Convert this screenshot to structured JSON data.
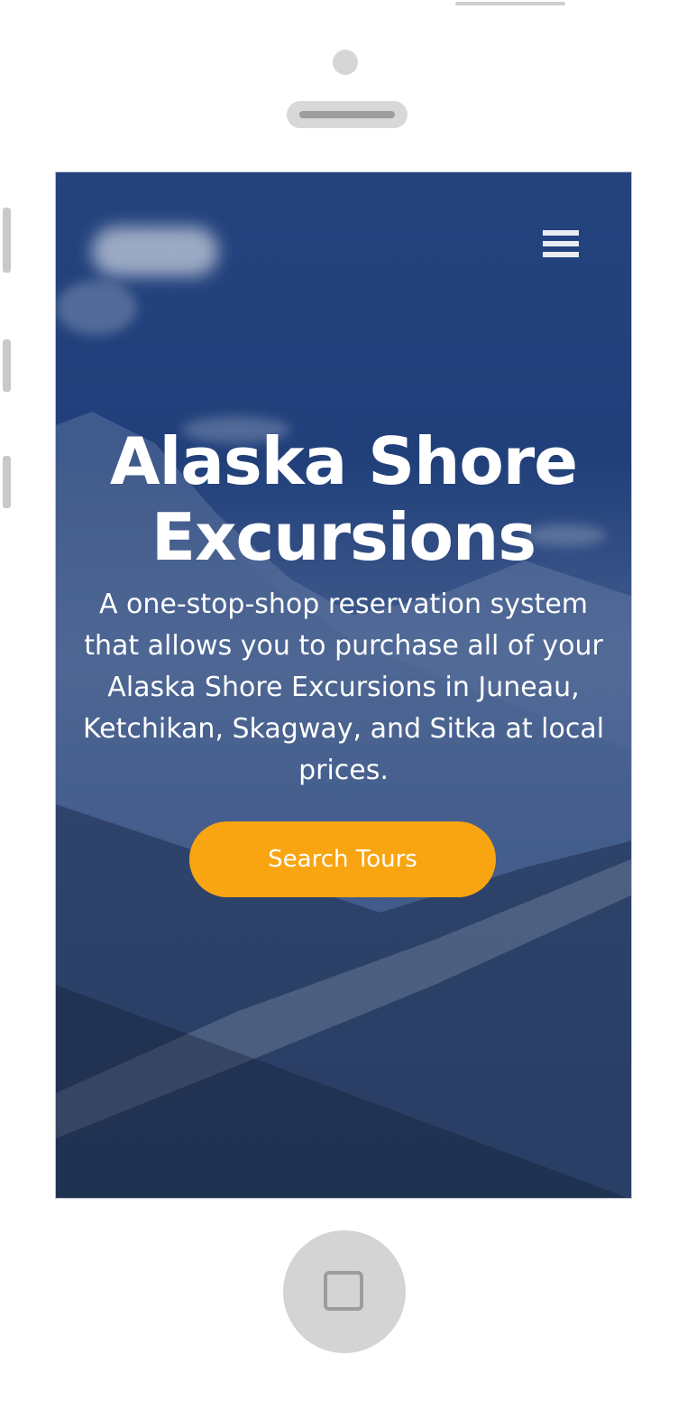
{
  "hero": {
    "title": "Alaska Shore Excursions",
    "subtitle": "A one-stop-shop reservation system that allows you to purchase all of your Alaska Shore Excursions in Juneau, Ketchikan, Skagway, and Sitka at local prices.",
    "cta_label": "Search Tours"
  },
  "header": {
    "menu_icon": "hamburger-menu-icon"
  },
  "colors": {
    "overlay": "#1f3a78",
    "cta": "#f9a512",
    "text": "#ffffff",
    "device_frame": "#d4d4d4"
  }
}
